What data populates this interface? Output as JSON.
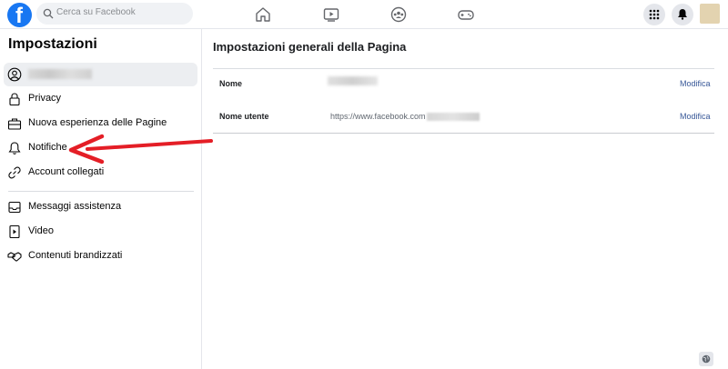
{
  "topbar": {
    "logo_letter": "f",
    "search_placeholder": "Cerca su Facebook",
    "nav_icons": [
      "home-icon",
      "video-icon",
      "groups-icon",
      "gaming-icon"
    ],
    "right_icons": [
      "menu-grid-icon",
      "notifications-bell-icon"
    ]
  },
  "sidebar": {
    "title": "Impostazioni",
    "items": [
      {
        "label": "",
        "icon": "profile-icon"
      },
      {
        "label": "Privacy",
        "icon": "lock-icon"
      },
      {
        "label": "Nuova esperienza delle Pagine",
        "icon": "briefcase-icon"
      },
      {
        "label": "Notifiche",
        "icon": "bell-icon"
      },
      {
        "label": "Account collegati",
        "icon": "link-icon"
      },
      {
        "label": "Messaggi assistenza",
        "icon": "inbox-icon"
      },
      {
        "label": "Video",
        "icon": "video-file-icon"
      },
      {
        "label": "Contenuti brandizzati",
        "icon": "handshake-icon"
      }
    ]
  },
  "main": {
    "title": "Impostazioni generali della Pagina",
    "rows": [
      {
        "label": "Nome",
        "value": "",
        "edit": "Modifica"
      },
      {
        "label": "Nome utente",
        "value": "https://www.facebook.com",
        "edit": "Modifica"
      }
    ]
  },
  "colors": {
    "brand": "#1877f2",
    "link": "#385898",
    "annotation_arrow": "#e41e26"
  }
}
